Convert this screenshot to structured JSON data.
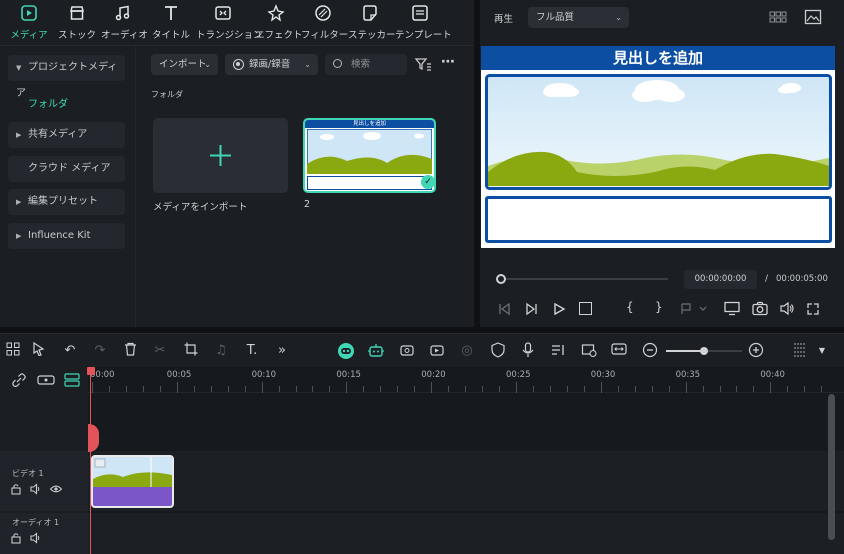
{
  "top_tabs": [
    {
      "label": "メディア",
      "icon": "media-icon"
    },
    {
      "label": "ストック",
      "icon": "stock-icon"
    },
    {
      "label": "オーディオ",
      "icon": "audio-icon"
    },
    {
      "label": "タイトル",
      "icon": "title-icon"
    },
    {
      "label": "トランジション",
      "icon": "transition-icon"
    },
    {
      "label": "エフェクト",
      "icon": "effect-icon"
    },
    {
      "label": "フィルター",
      "icon": "filter-icon"
    },
    {
      "label": "ステッカー",
      "icon": "sticker-icon"
    },
    {
      "label": "テンプレート",
      "icon": "template-icon"
    }
  ],
  "sidebar": {
    "project_media": "プロジェクトメディア",
    "folder": "フォルダ",
    "shared_media": "共有メディア",
    "cloud_media": "クラウド メディア",
    "edit_preset": "編集プリセット",
    "influence_kit": "Influence Kit"
  },
  "media_toolbar": {
    "import_label": "インポート",
    "record_label": "録画/録音",
    "search_placeholder": "検索"
  },
  "folder_title": "フォルダ",
  "media_items": [
    {
      "label": "メディアをインポート"
    },
    {
      "label": "2",
      "thumb_title": "見出しを追加"
    }
  ],
  "preview": {
    "play_label": "再生",
    "quality_label": "フル品質",
    "canvas_title": "見出しを追加",
    "current_time": "00:00:00:00",
    "separator": "/",
    "total_time": "00:00:05:00"
  },
  "timeline": {
    "ticks": [
      "00:00",
      "00:05",
      "00:10",
      "00:15",
      "00:20",
      "00:25",
      "00:30",
      "00:35",
      "00:40"
    ],
    "tracks": [
      {
        "label": "ビデオ 1"
      },
      {
        "label": "オーディオ 1"
      }
    ],
    "zoom_level": 0.5
  },
  "colors": {
    "accent": "#3fd7b5",
    "title_bar": "#0b4ea2",
    "sky_top": "#cfe6f6",
    "hills": "#8aa810",
    "clip_purple": "#7a56c9",
    "playhead": "#e2545a"
  }
}
